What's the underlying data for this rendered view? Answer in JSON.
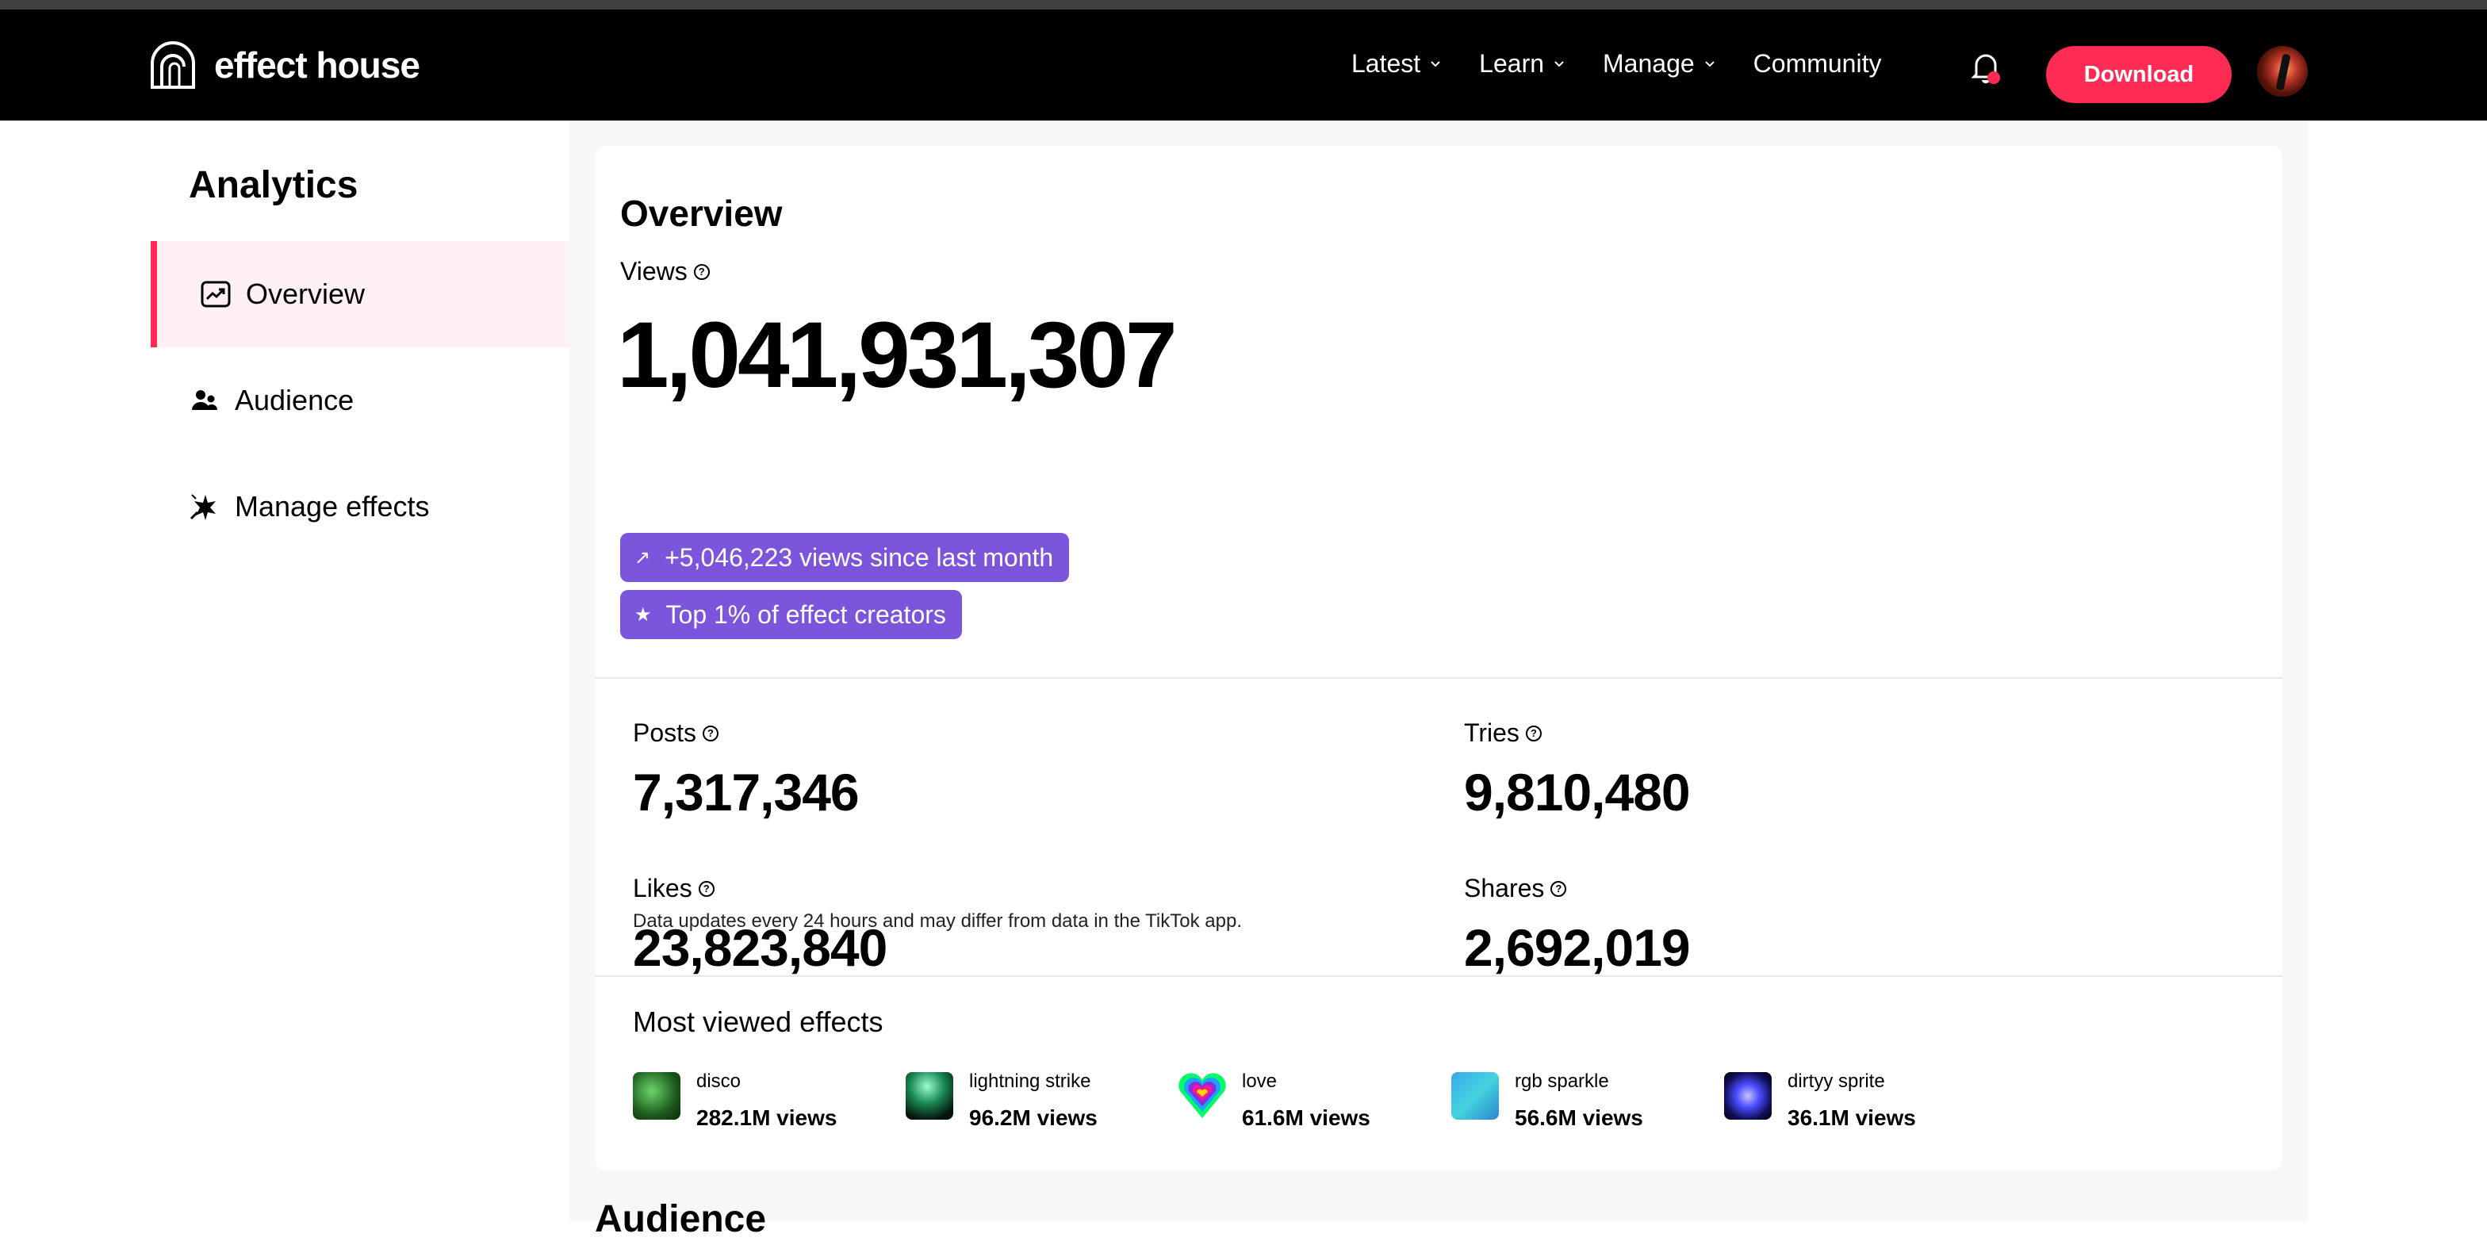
{
  "nav": {
    "logo_text": "effect house",
    "items": [
      {
        "label": "Latest",
        "has_dropdown": true
      },
      {
        "label": "Learn",
        "has_dropdown": true
      },
      {
        "label": "Manage",
        "has_dropdown": true
      },
      {
        "label": "Community",
        "has_dropdown": false
      }
    ],
    "download_label": "Download",
    "icons": {
      "bell": "bell-icon",
      "notification_dot": "notification-dot",
      "avatar": "user-avatar"
    },
    "accent_color": "#fe2c55"
  },
  "sidebar": {
    "title": "Analytics",
    "items": [
      {
        "label": "Overview",
        "icon": "chart-trend-icon",
        "active": true
      },
      {
        "label": "Audience",
        "icon": "people-icon",
        "active": false
      },
      {
        "label": "Manage effects",
        "icon": "sparkle-effect-icon",
        "active": false
      }
    ]
  },
  "overview": {
    "title": "Overview",
    "views_label": "Views",
    "views_value": "1,041,931,307",
    "pills": [
      {
        "icon": "↗",
        "text": "+5,046,223 views since last month"
      },
      {
        "icon": "★",
        "text": "Top 1% of effect creators"
      }
    ],
    "pill_color": "#7b55dc",
    "stats": [
      {
        "label": "Posts",
        "value": "7,317,346"
      },
      {
        "label": "Tries",
        "value": "9,810,480"
      },
      {
        "label": "Likes",
        "value": "23,823,840"
      },
      {
        "label": "Shares",
        "value": "2,692,019"
      }
    ],
    "note": "Data updates every 24 hours and may differ from data in the TikTok app.",
    "help_icon": "?"
  },
  "most_viewed": {
    "title": "Most viewed effects",
    "effects": [
      {
        "name": "disco",
        "views": "282.1M views"
      },
      {
        "name": "lightning strike",
        "views": "96.2M views"
      },
      {
        "name": "love",
        "views": "61.6M views"
      },
      {
        "name": "rgb sparkle",
        "views": "56.6M views"
      },
      {
        "name": "dirtyy sprite",
        "views": "36.1M views"
      }
    ]
  },
  "audience_heading": "Audience"
}
